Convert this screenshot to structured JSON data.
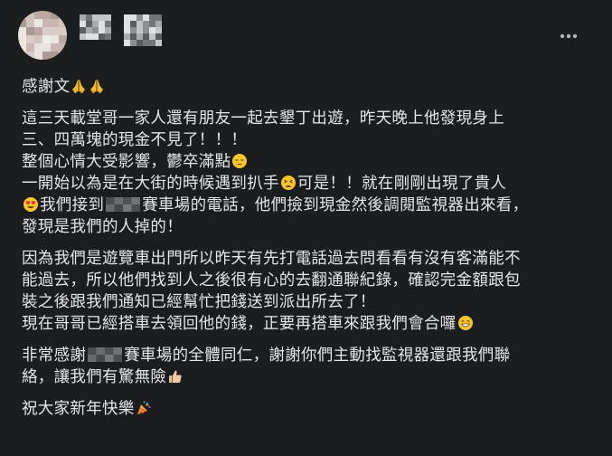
{
  "post": {
    "paragraphs": [
      {
        "lines": [
          [
            {
              "t": "感謝文"
            },
            {
              "e": "pray-icon"
            },
            {
              "e": "pray-icon"
            }
          ]
        ]
      },
      {
        "lines": [
          [
            {
              "t": "這三天載堂哥一家人還有朋友一起去墾丁出遊，昨天晚上他發現身上"
            }
          ],
          [
            {
              "t": "三、四萬塊的現金不見了！！！"
            }
          ],
          [
            {
              "t": "整個心情大受影響，鬱卒滿點"
            },
            {
              "e": "pensive-face-icon"
            }
          ],
          [
            {
              "t": "一開始以為是在大街的時候遇到扒手"
            },
            {
              "e": "tired-face-icon"
            },
            {
              "t": "可是！！就在剛剛出現了貴人"
            }
          ],
          [
            {
              "e": "heart-eyes-icon"
            },
            {
              "t": "我們接到"
            },
            {
              "r": true
            },
            {
              "t": "賽車場的電話，他們撿到現金然後調閱監視器出來看，"
            }
          ],
          [
            {
              "t": "發現是我們的人掉的！"
            }
          ]
        ]
      },
      {
        "lines": [
          [
            {
              "t": "因為我們是遊覽車出門所以昨天有先打電話過去問看看有沒有客滿能不"
            }
          ],
          [
            {
              "t": "能過去，所以他們找到人之後很有心的去翻通聯紀錄，確認完金額跟包"
            }
          ],
          [
            {
              "t": "裝之後跟我們通知已經幫忙把錢送到派出所去了！"
            }
          ],
          [
            {
              "t": "現在哥哥已經搭車去領回他的錢，正要再搭車來跟我們會合囉"
            },
            {
              "e": "grinning-face-icon"
            }
          ]
        ]
      },
      {
        "lines": [
          [
            {
              "t": "非常感謝"
            },
            {
              "r": true
            },
            {
              "t": "賽車場的全體同仁，謝謝你們主動找監視器還跟我們聯"
            }
          ],
          [
            {
              "t": "絡，讓我們有驚無險"
            },
            {
              "e": "thumbs-up-icon"
            }
          ]
        ]
      },
      {
        "lines": [
          [
            {
              "t": "祝大家新年快樂"
            },
            {
              "e": "party-popper-icon"
            }
          ]
        ]
      }
    ]
  },
  "header": {
    "more_icon": "more-horizontal-icon"
  },
  "colors": {
    "background": "#1c1d1f",
    "text": "#e4e6eb",
    "icon": "#b0b3b8"
  }
}
